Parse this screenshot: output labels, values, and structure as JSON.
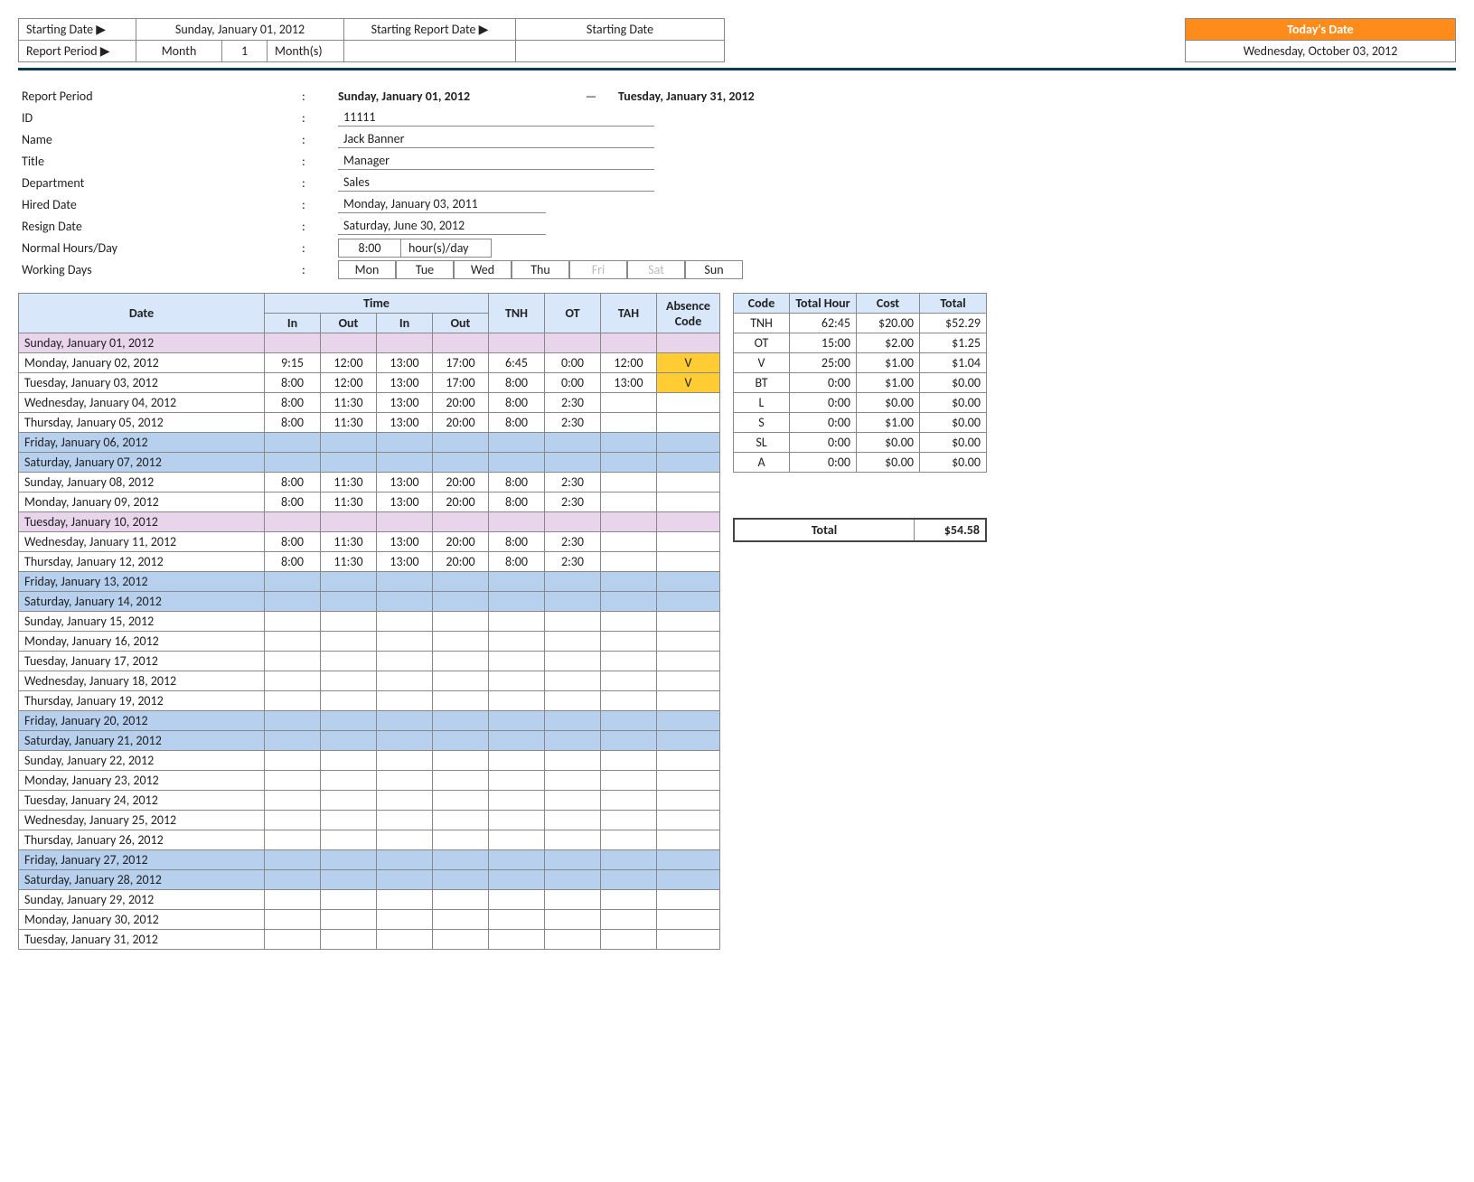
{
  "topbar": {
    "starting_date_label": "Starting Date ▶",
    "starting_date_value": "Sunday, January 01, 2012",
    "report_period_label": "Report Period ▶",
    "report_period_unit": "Month",
    "report_period_qty": "1",
    "report_period_suffix": "Month(s)",
    "starting_report_label": "Starting Report Date ▶",
    "starting_report_value": "Starting Date",
    "todays_date_label": "Today's Date",
    "todays_date_value": "Wednesday, October 03, 2012"
  },
  "info": {
    "report_period_label": "Report Period",
    "report_start": "Sunday, January 01, 2012",
    "report_dash": "—",
    "report_end": "Tuesday, January 31, 2012",
    "id_label": "ID",
    "id_value": "11111",
    "name_label": "Name",
    "name_value": "Jack Banner",
    "title_label": "Title",
    "title_value": "Manager",
    "dept_label": "Department",
    "dept_value": "Sales",
    "hired_label": "Hired Date",
    "hired_value": "Monday, January 03, 2011",
    "resign_label": "Resign Date",
    "resign_value": "Saturday, June 30, 2012",
    "normal_label": "Normal Hours/Day",
    "normal_hours": "8:00",
    "normal_suffix": "hour(s)/day",
    "working_label": "Working Days",
    "days": [
      "Mon",
      "Tue",
      "Wed",
      "Thu",
      "Fri",
      "Sat",
      "Sun"
    ],
    "days_off": [
      false,
      false,
      false,
      false,
      true,
      true,
      false
    ]
  },
  "ts_headers": {
    "date": "Date",
    "time": "Time",
    "in": "In",
    "out": "Out",
    "tnh": "TNH",
    "ot": "OT",
    "tah": "TAH",
    "abs": "Absence Code"
  },
  "timesheet": [
    {
      "date": "Sunday, January 01, 2012",
      "cls": "row-sun1"
    },
    {
      "date": "Monday, January 02, 2012",
      "in1": "9:15",
      "out1": "12:00",
      "in2": "13:00",
      "out2": "17:00",
      "tnh": "6:45",
      "ot": "0:00",
      "tah": "12:00",
      "abs": "V",
      "absCls": "code-V"
    },
    {
      "date": "Tuesday, January 03, 2012",
      "in1": "8:00",
      "out1": "12:00",
      "in2": "13:00",
      "out2": "17:00",
      "tnh": "8:00",
      "ot": "0:00",
      "tah": "13:00",
      "abs": "V",
      "absCls": "code-V"
    },
    {
      "date": "Wednesday, January 04, 2012",
      "in1": "8:00",
      "out1": "11:30",
      "in2": "13:00",
      "out2": "20:00",
      "tnh": "8:00",
      "ot": "2:30"
    },
    {
      "date": "Thursday, January 05, 2012",
      "in1": "8:00",
      "out1": "11:30",
      "in2": "13:00",
      "out2": "20:00",
      "tnh": "8:00",
      "ot": "2:30"
    },
    {
      "date": "Friday, January 06, 2012",
      "cls": "row-wkend"
    },
    {
      "date": "Saturday, January 07, 2012",
      "cls": "row-wkend"
    },
    {
      "date": "Sunday, January 08, 2012",
      "in1": "8:00",
      "out1": "11:30",
      "in2": "13:00",
      "out2": "20:00",
      "tnh": "8:00",
      "ot": "2:30"
    },
    {
      "date": "Monday, January 09, 2012",
      "in1": "8:00",
      "out1": "11:30",
      "in2": "13:00",
      "out2": "20:00",
      "tnh": "8:00",
      "ot": "2:30"
    },
    {
      "date": "Tuesday, January 10, 2012",
      "cls": "row-holiday"
    },
    {
      "date": "Wednesday, January 11, 2012",
      "in1": "8:00",
      "out1": "11:30",
      "in2": "13:00",
      "out2": "20:00",
      "tnh": "8:00",
      "ot": "2:30"
    },
    {
      "date": "Thursday, January 12, 2012",
      "in1": "8:00",
      "out1": "11:30",
      "in2": "13:00",
      "out2": "20:00",
      "tnh": "8:00",
      "ot": "2:30"
    },
    {
      "date": "Friday, January 13, 2012",
      "cls": "row-wkend"
    },
    {
      "date": "Saturday, January 14, 2012",
      "cls": "row-wkend"
    },
    {
      "date": "Sunday, January 15, 2012"
    },
    {
      "date": "Monday, January 16, 2012"
    },
    {
      "date": "Tuesday, January 17, 2012"
    },
    {
      "date": "Wednesday, January 18, 2012"
    },
    {
      "date": "Thursday, January 19, 2012"
    },
    {
      "date": "Friday, January 20, 2012",
      "cls": "row-wkend"
    },
    {
      "date": "Saturday, January 21, 2012",
      "cls": "row-wkend"
    },
    {
      "date": "Sunday, January 22, 2012"
    },
    {
      "date": "Monday, January 23, 2012"
    },
    {
      "date": "Tuesday, January 24, 2012"
    },
    {
      "date": "Wednesday, January 25, 2012"
    },
    {
      "date": "Thursday, January 26, 2012"
    },
    {
      "date": "Friday, January 27, 2012",
      "cls": "row-wkend"
    },
    {
      "date": "Saturday, January 28, 2012",
      "cls": "row-wkend"
    },
    {
      "date": "Sunday, January 29, 2012"
    },
    {
      "date": "Monday, January 30, 2012"
    },
    {
      "date": "Tuesday, January 31, 2012"
    }
  ],
  "summary_headers": {
    "code": "Code",
    "hour": "Total Hour",
    "cost": "Cost",
    "total": "Total"
  },
  "summary": [
    {
      "code": "TNH",
      "hour": "62:45",
      "cost": "$20.00",
      "total": "$52.29"
    },
    {
      "code": "OT",
      "hour": "15:00",
      "cost": "$2.00",
      "total": "$1.25"
    },
    {
      "code": "V",
      "hour": "25:00",
      "cost": "$1.00",
      "total": "$1.04"
    },
    {
      "code": "BT",
      "hour": "0:00",
      "cost": "$1.00",
      "total": "$0.00"
    },
    {
      "code": "L",
      "hour": "0:00",
      "cost": "$0.00",
      "total": "$0.00"
    },
    {
      "code": "S",
      "hour": "0:00",
      "cost": "$1.00",
      "total": "$0.00"
    },
    {
      "code": "SL",
      "hour": "0:00",
      "cost": "$0.00",
      "total": "$0.00"
    },
    {
      "code": "A",
      "hour": "0:00",
      "cost": "$0.00",
      "total": "$0.00"
    }
  ],
  "grand": {
    "label": "Total",
    "value": "$54.58"
  }
}
